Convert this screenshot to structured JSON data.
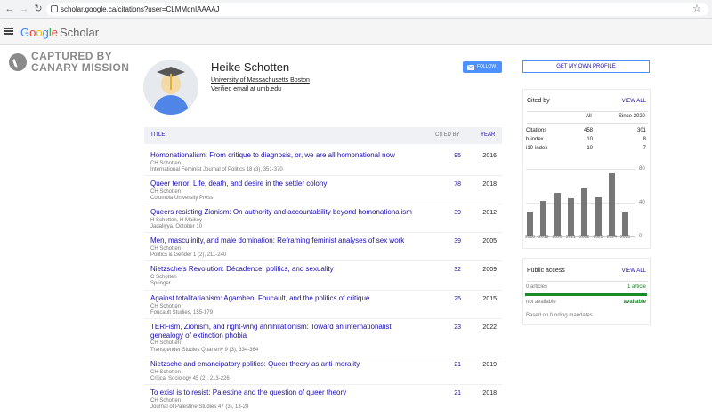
{
  "browser": {
    "url": "scholar.google.ca/citations?user=CLMMqnIAAAAJ"
  },
  "header": {
    "logo_google": [
      "G",
      "o",
      "o",
      "g",
      "l",
      "e"
    ],
    "logo_scholar": "Scholar"
  },
  "watermark": {
    "line1": "CAPTURED BY",
    "line2": "CANARY MISSION"
  },
  "profile": {
    "name": "Heike Schotten",
    "affiliation": "University of Massachusetts Boston",
    "email": "Verified email at umb.edu",
    "follow_label": "FOLLOW",
    "my_profile_label": "GET MY OWN PROFILE"
  },
  "table": {
    "col_title": "TITLE",
    "col_cited": "CITED BY",
    "col_year": "YEAR",
    "articles": [
      {
        "title": "Homonationalism: From critique to diagnosis, or, we are all homonational now",
        "authors": "CH Schotten",
        "venue": "International Feminist Journal of Politics 18 (3), 351-370",
        "cited": "95",
        "year": "2016"
      },
      {
        "title": "Queer terror: Life, death, and desire in the settler colony",
        "authors": "CH Schotten",
        "venue": "Columbia University Press",
        "cited": "78",
        "year": "2018"
      },
      {
        "title": "Queers resisting Zionism: On authority and accountability beyond homonationalism",
        "authors": "H Schotten, H Maikey",
        "venue": "Jadaliyya, October 10",
        "cited": "39",
        "year": "2012"
      },
      {
        "title": "Men, masculinity, and male domination: Reframing feminist analyses of sex work",
        "authors": "CH Schotten",
        "venue": "Politics & Gender 1 (2), 211-240",
        "cited": "39",
        "year": "2005"
      },
      {
        "title": "Nietzsche's Revolution: Décadence, politics, and sexuality",
        "authors": "C Schotten",
        "venue": "Springer",
        "cited": "32",
        "year": "2009"
      },
      {
        "title": "Against totalitarianism: Agamben, Foucault, and the politics of critique",
        "authors": "CH Schotten",
        "venue": "Foucault Studies, 155-179",
        "cited": "25",
        "year": "2015"
      },
      {
        "title": "TERFism, Zionism, and right-wing annihilationism: Toward an internationalist genealogy of extinction phobia",
        "authors": "CH Schotten",
        "venue": "Transgender Studies Quarterly 9 (3), 334-364",
        "cited": "23",
        "year": "2022"
      },
      {
        "title": "Nietzsche and emancipatory politics: Queer theory as anti-morality",
        "authors": "CH Schotten",
        "venue": "Critical Sociology 45 (2), 213-226",
        "cited": "21",
        "year": "2019"
      },
      {
        "title": "To exist is to resist: Palestine and the question of queer theory",
        "authors": "CH Schotten",
        "venue": "Journal of Palestine Studies 47 (3), 13-28",
        "cited": "21",
        "year": "2018"
      }
    ]
  },
  "cited_by": {
    "title": "Cited by",
    "view_all": "VIEW ALL",
    "col_all": "All",
    "col_since": "Since 2020",
    "rows": [
      {
        "label": "Citations",
        "all": "458",
        "since": "301"
      },
      {
        "label": "h-index",
        "all": "10",
        "since": "8"
      },
      {
        "label": "i10-index",
        "all": "10",
        "since": "7"
      }
    ]
  },
  "chart_data": {
    "type": "bar",
    "categories": [
      "2018",
      "2019",
      "2020",
      "2021",
      "2022",
      "2023",
      "2024",
      "2025"
    ],
    "values": [
      28,
      42,
      52,
      45,
      57,
      46,
      75,
      28
    ],
    "ylim": [
      0,
      80
    ],
    "yticks": [
      "80",
      "40",
      "0"
    ]
  },
  "public_access": {
    "title": "Public access",
    "view_all": "VIEW ALL",
    "not_available_count": "0 articles",
    "available_count": "1 article",
    "not_available_label": "not available",
    "available_label": "available",
    "note": "Based on funding mandates"
  }
}
